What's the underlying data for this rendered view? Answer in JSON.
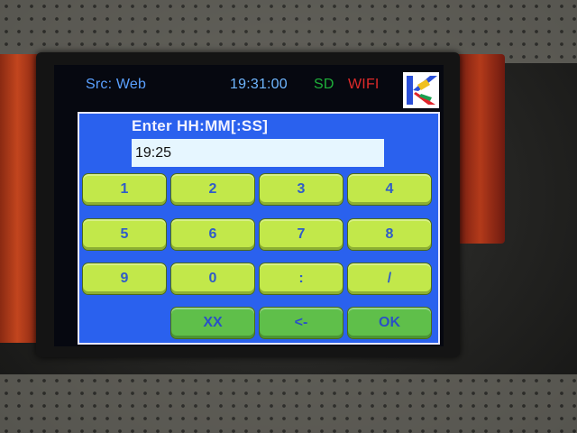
{
  "status_bar": {
    "source": "Src: Web",
    "time": "19:31:00",
    "sd": "SD",
    "wifi": "WIFI",
    "logo_icon": "k-logo-icon"
  },
  "dialog": {
    "prompt": "Enter HH:MM[:SS]",
    "input_value": "19:25"
  },
  "keypad": {
    "row1": [
      "1",
      "2",
      "3",
      "4"
    ],
    "row2": [
      "5",
      "6",
      "7",
      "8"
    ],
    "row3": [
      "9",
      "0",
      ":",
      "/"
    ],
    "row4": [
      "XX",
      "<-",
      "OK"
    ]
  },
  "colors": {
    "dialog_bg": "#2a61ee",
    "key_bg": "#c2e84a",
    "key_action_bg": "#5fbf4a",
    "status_source": "#5aa0ff",
    "status_sd": "#1eb03a",
    "status_wifi": "#e02a2a"
  }
}
